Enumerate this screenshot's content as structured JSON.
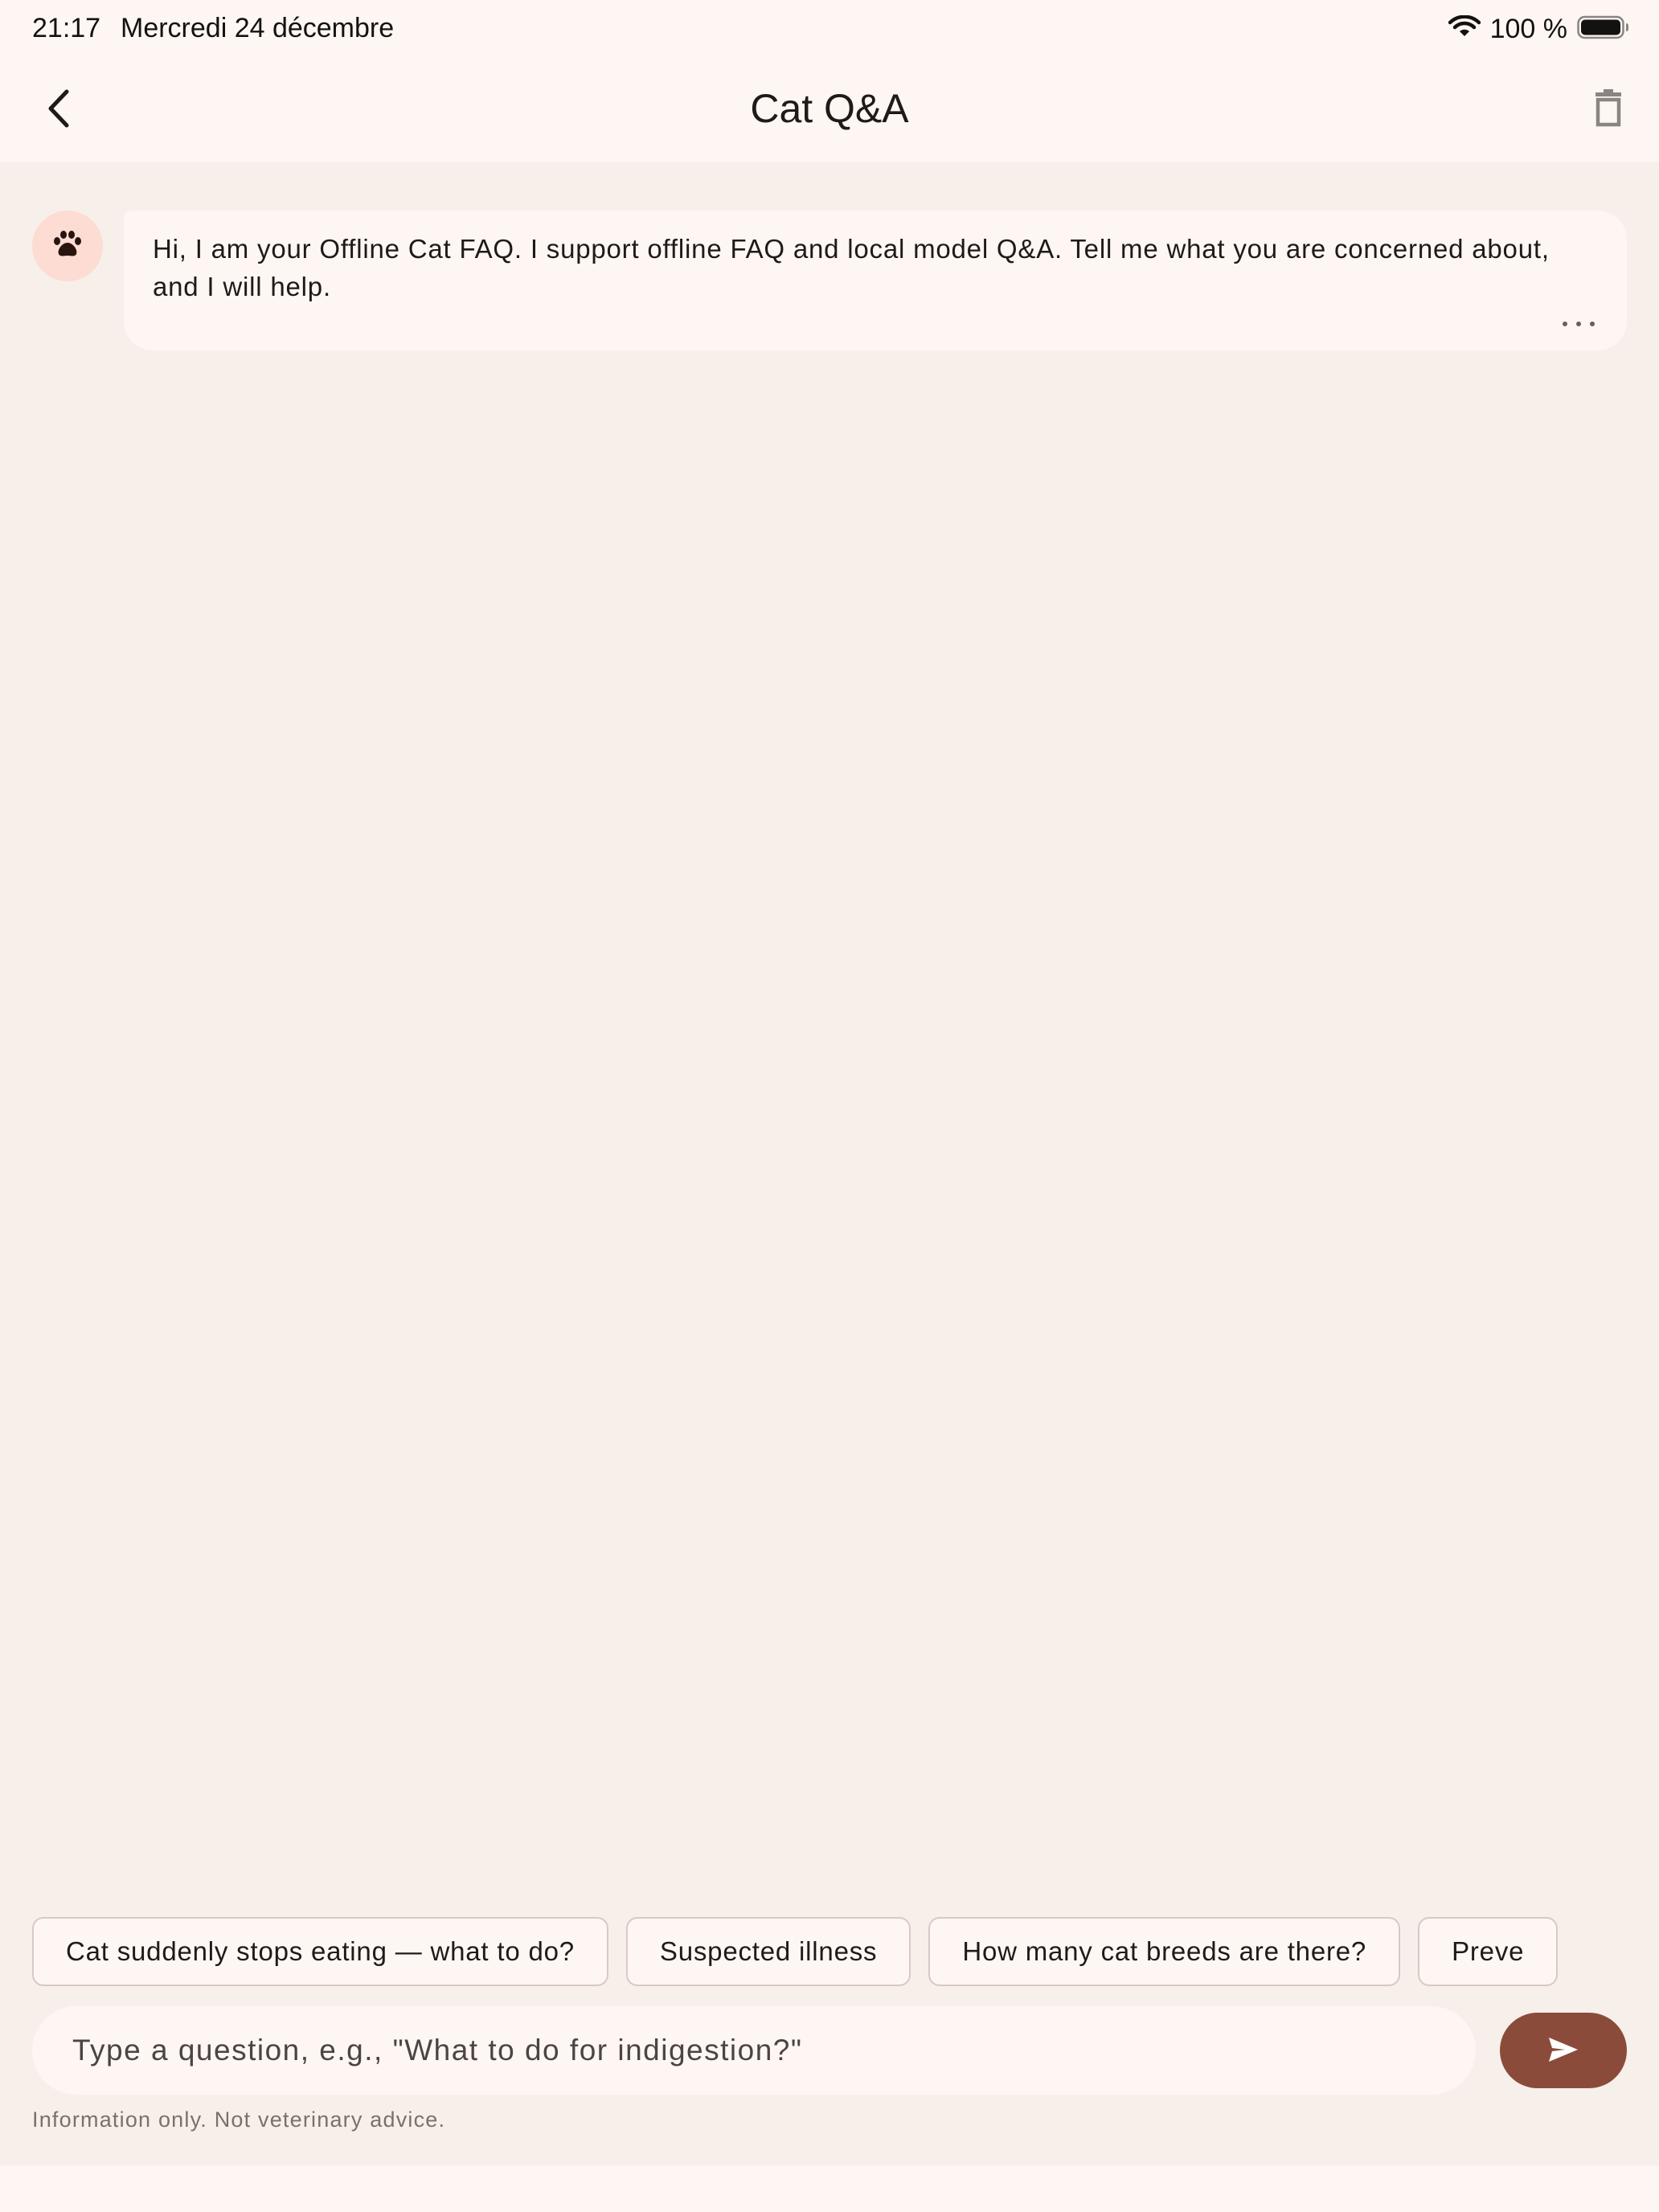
{
  "status_bar": {
    "time": "21:17",
    "date": "Mercredi 24 décembre",
    "battery_percent": "100 %",
    "wifi_icon": "wifi-icon",
    "battery_icon": "battery-icon",
    "battery_level": 1.0
  },
  "header": {
    "title": "Cat Q&A",
    "back_icon": "chevron-left-icon",
    "delete_icon": "trash-icon"
  },
  "messages": [
    {
      "sender": "bot",
      "avatar_icon": "paw-icon",
      "text": "Hi, I am your Offline Cat FAQ. I support offline FAQ and local model Q&A. Tell me what you are concerned about, and I will help.",
      "more_icon": "more-horizontal-icon"
    }
  ],
  "suggestions": [
    "Cat suddenly stops eating — what to do?",
    "Suspected illness",
    "How many cat breeds are there?",
    "Preve"
  ],
  "input": {
    "value": "",
    "placeholder": "Type a question, e.g., \"What to do for indigestion?\"",
    "send_icon": "send-icon"
  },
  "disclaimer": "Information only. Not veterinary advice.",
  "colors": {
    "background": "#fdf6f3",
    "chat_background": "#f7efea",
    "accent": "#8b4b3b",
    "avatar_bg": "#fcdcd3",
    "chip_border": "#d9c9c3"
  }
}
